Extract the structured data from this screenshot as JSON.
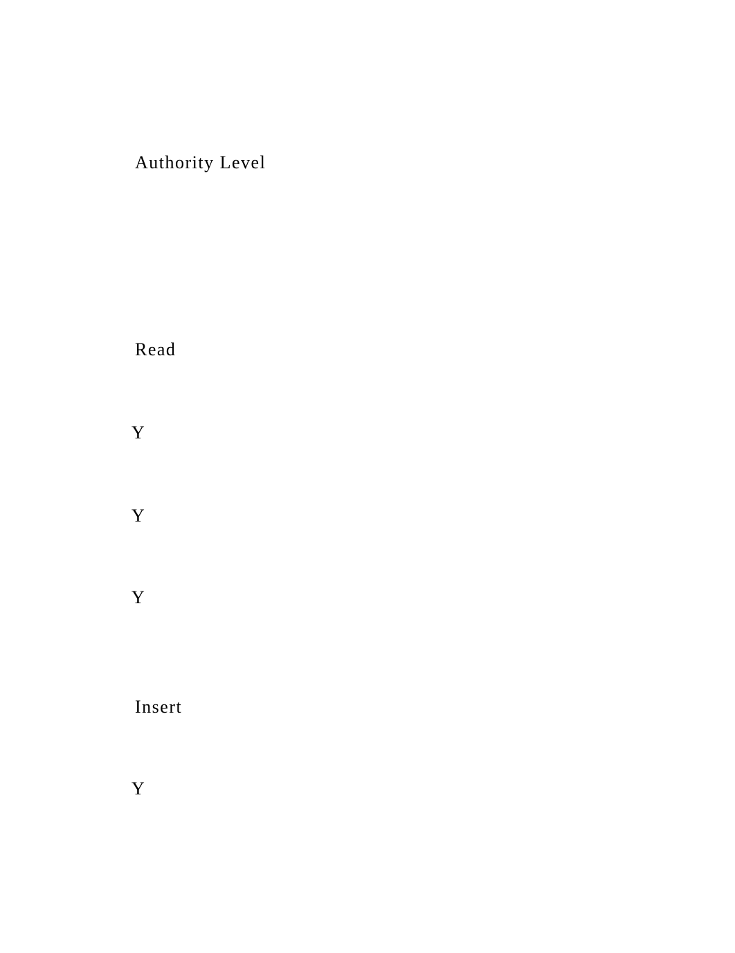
{
  "heading": "Authority Level",
  "sections": {
    "read": {
      "label": "Read",
      "values": [
        "Y",
        "Y",
        "Y"
      ]
    },
    "insert": {
      "label": "Insert",
      "values": [
        "Y"
      ]
    }
  }
}
